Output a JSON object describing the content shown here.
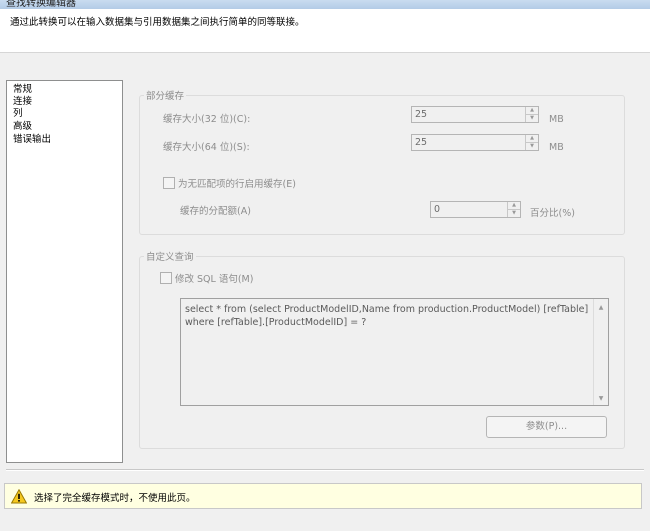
{
  "window": {
    "title": "查找转换编辑器"
  },
  "header": {
    "description": "通过此转换可以在输入数据集与引用数据集之间执行简单的同等联接。"
  },
  "nav": {
    "items": [
      "常规",
      "连接",
      "列",
      "高级",
      "错误输出"
    ]
  },
  "partial_cache": {
    "legend": "部分缓存",
    "size32_label": "缓存大小(32 位)(C):",
    "size32_value": "25",
    "size32_unit": "MB",
    "size64_label": "缓存大小(64 位)(S):",
    "size64_value": "25",
    "size64_unit": "MB",
    "enable_miss_label": "为无匹配项的行启用缓存(E)",
    "alloc_label": "缓存的分配额(A)",
    "alloc_value": "0",
    "alloc_unit": "百分比(%)"
  },
  "custom_query": {
    "legend": "自定义查询",
    "modify_sql_label": "修改 SQL 语句(M)",
    "sql_text": "select * from (select ProductModelID,Name from production.ProductModel) [refTable]\nwhere [refTable].[ProductModelID] = ?",
    "params_button": "参数(P)..."
  },
  "message": {
    "icon": "warning-icon",
    "text": "选择了完全缓存模式时，不使用此页。"
  }
}
